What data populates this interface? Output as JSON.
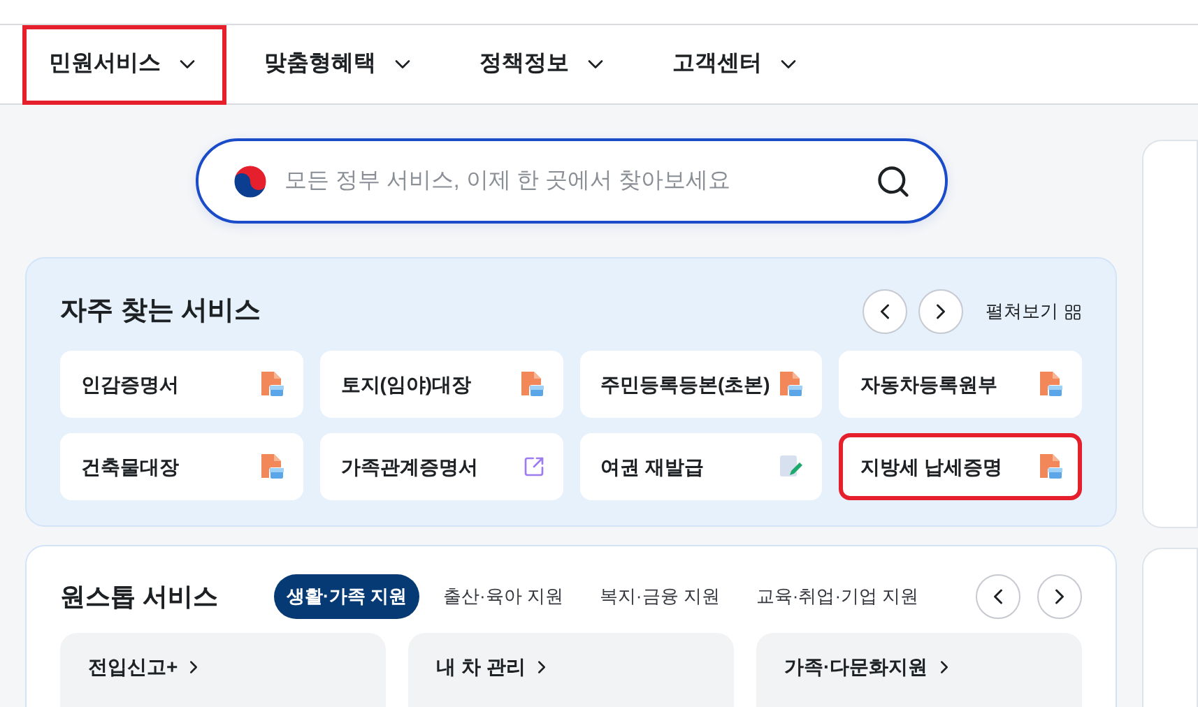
{
  "nav": [
    {
      "label": "민원서비스",
      "highlighted": true
    },
    {
      "label": "맞춤형혜택",
      "highlighted": false
    },
    {
      "label": "정책정보",
      "highlighted": false
    },
    {
      "label": "고객센터",
      "highlighted": false
    }
  ],
  "search": {
    "placeholder": "모든 정부 서비스, 이제 한 곳에서 찾아보세요"
  },
  "frequent_services": {
    "title": "자주 찾는 서비스",
    "expand_label": "펼쳐보기",
    "items": [
      {
        "label": "인감증명서",
        "kind": "document",
        "highlighted": false
      },
      {
        "label": "토지(임야)대장",
        "kind": "document",
        "highlighted": false
      },
      {
        "label": "주민등록등본(초본)",
        "kind": "document",
        "highlighted": false
      },
      {
        "label": "자동차등록원부",
        "kind": "document",
        "highlighted": false
      },
      {
        "label": "건축물대장",
        "kind": "document",
        "highlighted": false
      },
      {
        "label": "가족관계증명서",
        "kind": "external",
        "highlighted": false
      },
      {
        "label": "여권 재발급",
        "kind": "edit",
        "highlighted": false
      },
      {
        "label": "지방세 납세증명",
        "kind": "document",
        "highlighted": true
      }
    ]
  },
  "one_stop": {
    "title": "원스톱 서비스",
    "tabs": [
      {
        "label": "생활·가족 지원",
        "selected": true
      },
      {
        "label": "출산·육아 지원",
        "selected": false
      },
      {
        "label": "복지·금융 지원",
        "selected": false
      },
      {
        "label": "교육·취업·기업 지원",
        "selected": false
      }
    ],
    "cards": [
      {
        "title": "전입신고+"
      },
      {
        "title": "내 차 관리"
      },
      {
        "title": "가족·다문화지원"
      }
    ]
  }
}
